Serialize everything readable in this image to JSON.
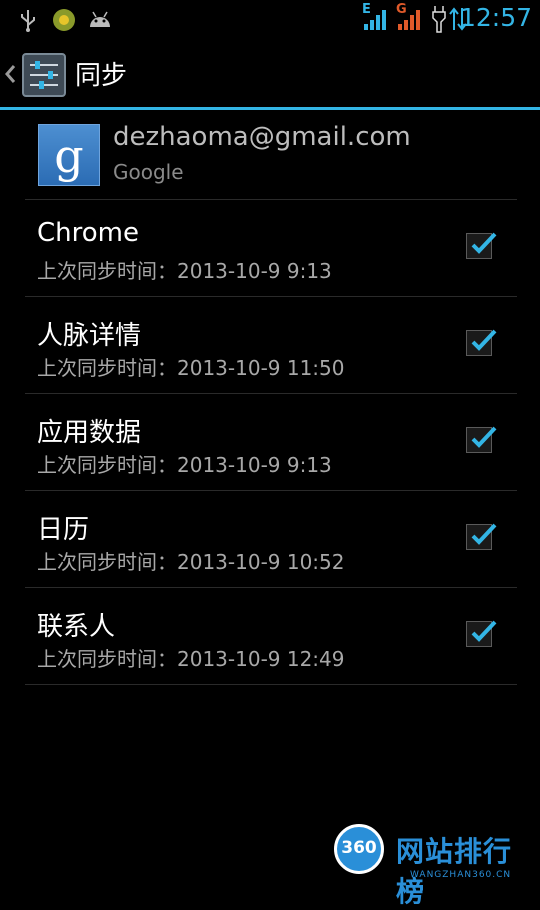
{
  "status_bar": {
    "time": "12:57",
    "network_label_1": "E",
    "network_label_2": "G",
    "icons": [
      "usb-icon",
      "app-notification-icon",
      "android-icon",
      "signal-icon",
      "signal-icon",
      "charging-icon",
      "data-transfer-icon"
    ]
  },
  "action_bar": {
    "title": "同步",
    "icon": "settings-sliders-icon"
  },
  "account": {
    "logo_letter": "g",
    "email": "dezhaoma@gmail.com",
    "type": "Google"
  },
  "sync_items": [
    {
      "title": "Chrome",
      "summary": "上次同步时间：2013-10-9 9:13",
      "checked": true
    },
    {
      "title": "人脉详情",
      "summary": "上次同步时间：2013-10-9 11:50",
      "checked": true
    },
    {
      "title": "应用数据",
      "summary": "上次同步时间：2013-10-9 9:13",
      "checked": true
    },
    {
      "title": "日历",
      "summary": "上次同步时间：2013-10-9 10:52",
      "checked": true
    },
    {
      "title": "联系人",
      "summary": "上次同步时间：2013-10-9 12:49",
      "checked": true
    }
  ],
  "watermark": {
    "logo_text": "360",
    "brand": "网站排行榜",
    "sub": "WANGZHAN360.CN"
  },
  "colors": {
    "accent": "#33b5e5",
    "checkmark": "#33b5e5",
    "google_blue": "#2b6cb4"
  }
}
